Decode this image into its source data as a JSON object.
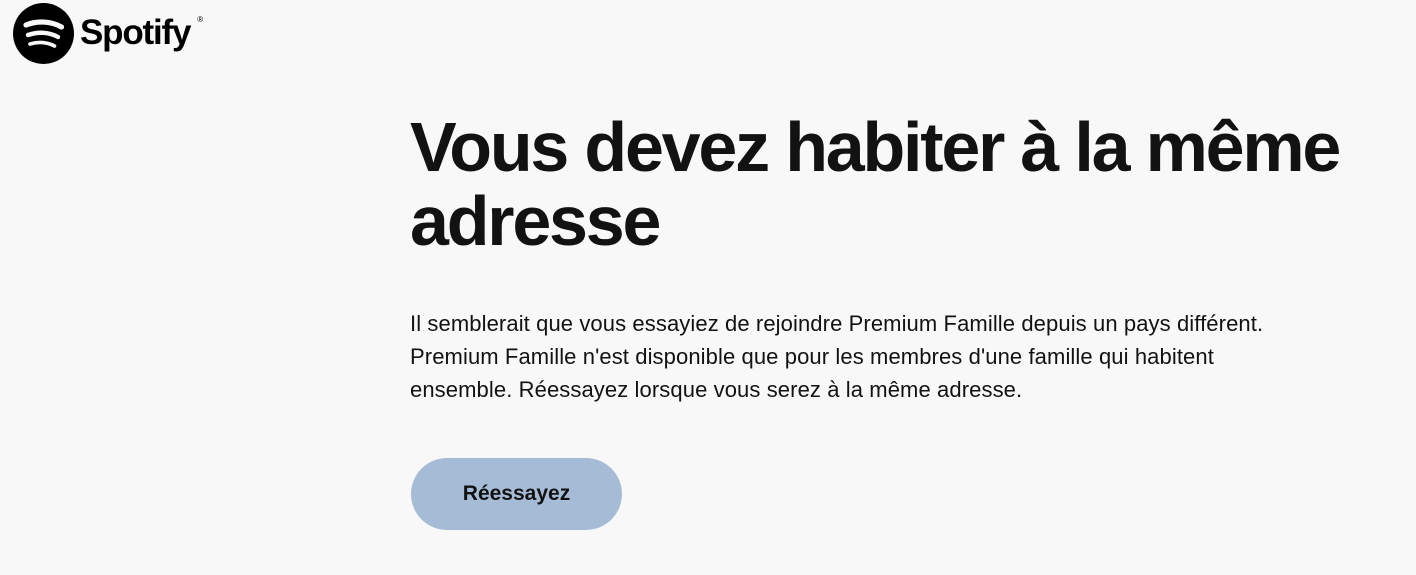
{
  "brand": {
    "name": "Spotify",
    "registered_mark": "®",
    "logo_icon": "spotify-logo-icon",
    "color": "#000000"
  },
  "main": {
    "title": "Vous devez habiter à la même adresse",
    "description": "Il semblerait que vous essayiez de rejoindre Premium Famille depuis un pays différent. Premium Famille n'est disponible que pour les membres d'une famille qui habitent ensemble. Réessayez lorsque vous serez à la même adresse.",
    "retry_button_label": "Réessayez"
  },
  "colors": {
    "background": "#f8f8f8",
    "text": "#121212",
    "button_background": "#a6bcd6"
  }
}
